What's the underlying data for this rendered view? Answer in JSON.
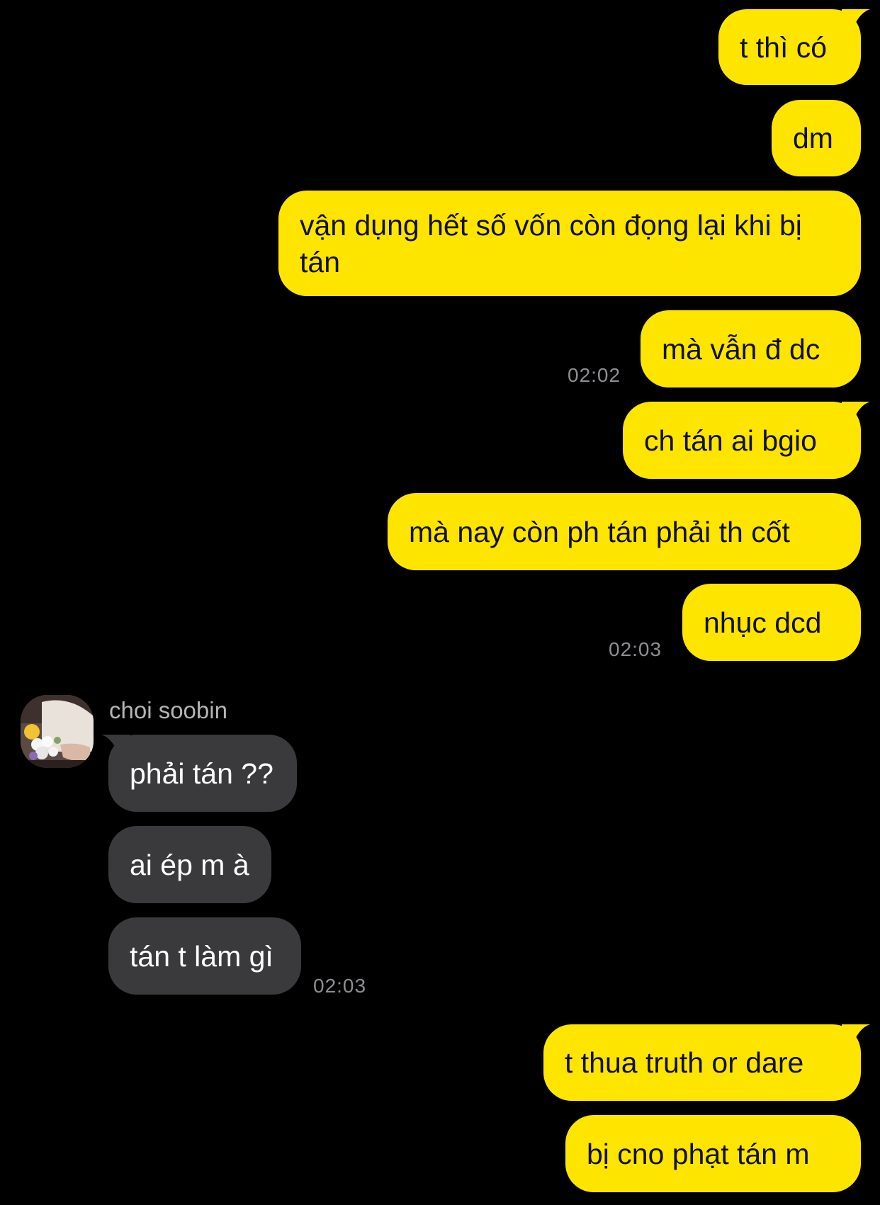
{
  "theme": {
    "background": "#000000",
    "outgoing_bubble": "#FEE500",
    "incoming_bubble": "#3A3A3C",
    "timestamp_color": "#8E8E93"
  },
  "messages_sent_1": [
    {
      "text": "t thì có"
    },
    {
      "text": "dm"
    },
    {
      "text": "vận dụng hết số vốn còn đọng lại khi bị tán"
    },
    {
      "text": "mà vẫn đ dc",
      "time": "02:02"
    },
    {
      "text": "ch tán ai bgio"
    },
    {
      "text": "mà nay còn ph tán phải th cốt"
    },
    {
      "text": "nhục dcd",
      "time": "02:03"
    }
  ],
  "contact": {
    "name": "choi soobin",
    "avatar_icon": "avatar-photo-flowers"
  },
  "messages_received": [
    {
      "text": "phải tán ??"
    },
    {
      "text": "ai ép m à"
    },
    {
      "text": "tán t làm gì",
      "time": "02:03"
    }
  ],
  "messages_sent_2": [
    {
      "text": "t thua truth or dare"
    },
    {
      "text": "bị cno phạt tán m"
    }
  ]
}
